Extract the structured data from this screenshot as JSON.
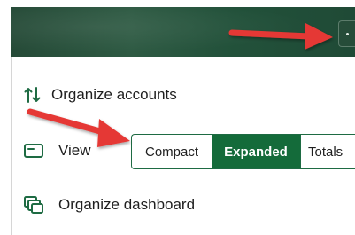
{
  "header": {
    "more_button_icon": "more-vertical-icon",
    "background_color": "#254a37"
  },
  "menu": {
    "organize_accounts": {
      "label": "Organize accounts",
      "icon": "sort-arrows-icon"
    },
    "view": {
      "label": "View",
      "icon": "view-card-icon",
      "options": [
        "Compact",
        "Expanded",
        "Totals"
      ],
      "selected": "Expanded"
    },
    "organize_dashboard": {
      "label": "Organize dashboard",
      "icon": "stacked-windows-icon"
    }
  },
  "annotations": {
    "arrow_color": "#e53935"
  },
  "colors": {
    "accent": "#146b3a",
    "text": "#1f1f1f"
  }
}
